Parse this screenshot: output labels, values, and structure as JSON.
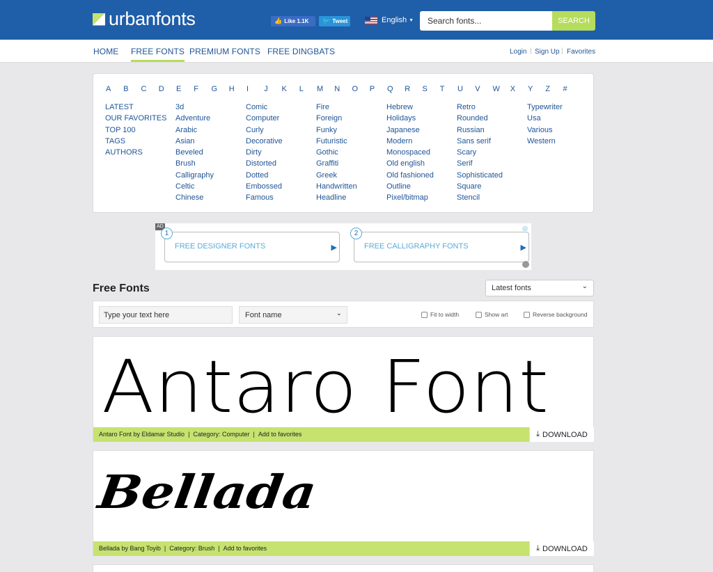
{
  "header": {
    "logo": "urbanfonts",
    "facebook_label": "Like 1.1K",
    "twitter_label": "Tweet",
    "language": "English",
    "search_placeholder": "Search fonts...",
    "search_button": "SEARCH"
  },
  "nav": {
    "items": [
      "HOME",
      "FREE FONTS",
      "PREMIUM FONTS",
      "FREE DINGBATS"
    ],
    "active": "FREE FONTS",
    "login": "Login",
    "signup": "Sign Up",
    "favorites": "Favorites"
  },
  "letters": [
    "A",
    "B",
    "C",
    "D",
    "E",
    "F",
    "G",
    "H",
    "I",
    "J",
    "K",
    "L",
    "M",
    "N",
    "O",
    "P",
    "Q",
    "R",
    "S",
    "T",
    "U",
    "V",
    "W",
    "X",
    "Y",
    "Z",
    "#"
  ],
  "categories": {
    "col1": [
      "LATEST",
      "OUR FAVORITES",
      "TOP 100",
      "TAGS",
      "AUTHORS"
    ],
    "col2": [
      "3d",
      "Adventure",
      "Arabic",
      "Asian",
      "Beveled",
      "Brush",
      "Calligraphy",
      "Celtic",
      "Chinese"
    ],
    "col3": [
      "Comic",
      "Computer",
      "Curly",
      "Decorative",
      "Dirty",
      "Distorted",
      "Dotted",
      "Embossed",
      "Famous"
    ],
    "col4": [
      "Fire",
      "Foreign",
      "Funky",
      "Futuristic",
      "Gothic",
      "Graffiti",
      "Greek",
      "Handwritten",
      "Headline"
    ],
    "col5": [
      "Hebrew",
      "Holidays",
      "Japanese",
      "Modern",
      "Monospaced",
      "Old english",
      "Old fashioned",
      "Outline",
      "Pixel/bitmap"
    ],
    "col6": [
      "Retro",
      "Rounded",
      "Russian",
      "Sans serif",
      "Scary",
      "Serif",
      "Sophisticated",
      "Square",
      "Stencil"
    ],
    "col7": [
      "Typewriter",
      "Usa",
      "Various",
      "Western"
    ]
  },
  "ads": {
    "badge": "AD",
    "items": [
      {
        "number": "1",
        "label": "FREE DESIGNER FONTS"
      },
      {
        "number": "2",
        "label": "FREE CALLIGRAPHY FONTS"
      }
    ]
  },
  "listing": {
    "title": "Free Fonts",
    "sort": "Latest fonts",
    "text_placeholder": "Type your text here",
    "font_name_select": "Font name",
    "checkboxes": [
      "Fit to width",
      "Show art",
      "Reverse background"
    ]
  },
  "fonts": [
    {
      "preview": "Antaro Font",
      "name_by": "Antaro Font by Eldamar Studio",
      "category": "Category: Computer",
      "add_fav": "Add to favorites",
      "download": "DOWNLOAD"
    },
    {
      "preview": "Bellada",
      "name_by": "Bellada by Bang Toyib",
      "category": "Category: Brush",
      "add_fav": "Add to favorites",
      "download": "DOWNLOAD"
    }
  ],
  "icons": {
    "download_icon": "download-icon",
    "chevron": "chevron-down-icon"
  }
}
